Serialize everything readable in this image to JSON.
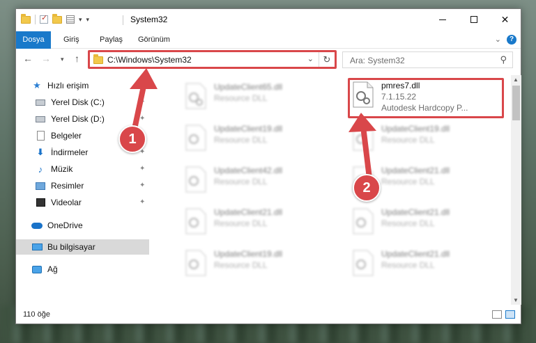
{
  "window": {
    "title": "System32",
    "minimize_label": "",
    "maximize_label": "",
    "close_label": "✕"
  },
  "ribbon": {
    "tabs": [
      {
        "label": "Dosya"
      },
      {
        "label": "Giriş"
      },
      {
        "label": "Paylaş"
      },
      {
        "label": "Görünüm"
      }
    ],
    "help": "?"
  },
  "navbar": {
    "address": "C:\\Windows\\System32",
    "search_placeholder": "Ara: System32"
  },
  "sidebar": {
    "items": [
      {
        "label": "Hızlı erişim",
        "icon": "star-icon"
      },
      {
        "label": "Yerel Disk (C:)",
        "icon": "drive-icon"
      },
      {
        "label": "Yerel Disk (D:)",
        "icon": "drive-icon"
      },
      {
        "label": "Belgeler",
        "icon": "documents-icon"
      },
      {
        "label": "İndirmeler",
        "icon": "download-icon"
      },
      {
        "label": "Müzik",
        "icon": "music-icon"
      },
      {
        "label": "Resimler",
        "icon": "pictures-icon"
      },
      {
        "label": "Videolar",
        "icon": "videos-icon"
      },
      {
        "label": "OneDrive",
        "icon": "cloud-icon"
      },
      {
        "label": "Bu bilgisayar",
        "icon": "computer-icon"
      },
      {
        "label": "Ağ",
        "icon": "network-icon"
      }
    ]
  },
  "files": [
    {
      "name": "UpdateClient65.dll",
      "type": "Resource DLL"
    },
    {
      "name": "pmres7.dll",
      "version": "7.1.15.22",
      "company": "Autodesk Hardcopy P..."
    },
    {
      "name": "UpdateClient19.dll",
      "type": "Resource DLL"
    },
    {
      "name": "UpdateClient19.dll",
      "type": "Resource DLL"
    },
    {
      "name": "UpdateClient42.dll",
      "type": "Resource DLL"
    },
    {
      "name": "UpdateClient21.dll",
      "type": "Resource DLL"
    },
    {
      "name": "UpdateClient21.dll",
      "type": "Resource DLL"
    },
    {
      "name": "UpdateClient21.dll",
      "type": "Resource DLL"
    },
    {
      "name": "UpdateClient19.dll",
      "type": "Resource DLL"
    },
    {
      "name": "UpdateClient21.dll",
      "type": "Resource DLL"
    }
  ],
  "status": {
    "count": "110 öğe"
  },
  "callouts": [
    {
      "number": "1"
    },
    {
      "number": "2"
    }
  ],
  "colors": {
    "accent": "#1979ca",
    "highlight": "#d9474a"
  }
}
